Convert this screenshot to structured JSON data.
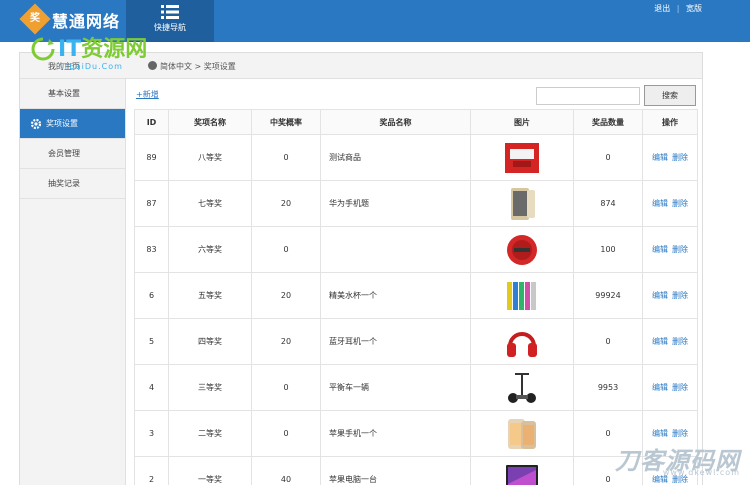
{
  "header": {
    "logo_badge": "奖",
    "brand": "慧通网络",
    "quicknav_label": "快捷导航",
    "links": [
      "退出",
      "宽版"
    ]
  },
  "watermark": {
    "title_left": "IT",
    "title_rest": "资源网",
    "sub": "ITBaiDu.Com"
  },
  "breadcrumb": {
    "home": "我的主页",
    "path": "简体中文 > 奖项设置"
  },
  "sidebar": {
    "items": [
      {
        "label": "基本设置"
      },
      {
        "label": "奖项设置"
      },
      {
        "label": "会员管理"
      },
      {
        "label": "抽奖记录"
      }
    ]
  },
  "toolbar": {
    "new_label": "+新增",
    "search_label": "搜索"
  },
  "table": {
    "headers": [
      "ID",
      "奖项名称",
      "中奖概率",
      "奖品名称",
      "图片",
      "奖品数量",
      "操作"
    ],
    "edit_label": "编辑",
    "delete_label": "删除",
    "rows": [
      {
        "id": "89",
        "level": "八等奖",
        "rate": "0",
        "name": "测试商品",
        "img": "red-box",
        "qty": "0"
      },
      {
        "id": "87",
        "level": "七等奖",
        "rate": "20",
        "name": "华为手机题",
        "img": "gold-phone",
        "qty": "874"
      },
      {
        "id": "83",
        "level": "六等奖",
        "rate": "0",
        "name": "",
        "img": "red-robot",
        "qty": "100"
      },
      {
        "id": "6",
        "level": "五等奖",
        "rate": "20",
        "name": "精美水杯一个",
        "img": "cups",
        "qty": "99924"
      },
      {
        "id": "5",
        "level": "四等奖",
        "rate": "20",
        "name": "蓝牙耳机一个",
        "img": "headphones",
        "qty": "0"
      },
      {
        "id": "4",
        "level": "三等奖",
        "rate": "0",
        "name": "平衡车一辆",
        "img": "segway",
        "qty": "9953"
      },
      {
        "id": "3",
        "level": "二等奖",
        "rate": "0",
        "name": "苹果手机一个",
        "img": "iphone",
        "qty": "0"
      },
      {
        "id": "2",
        "level": "一等奖",
        "rate": "40",
        "name": "苹果电脑一台",
        "img": "imac",
        "qty": "0"
      }
    ]
  },
  "corner_watermark": {
    "title": "刀客源码网",
    "sub": "www.dkewl.com"
  }
}
